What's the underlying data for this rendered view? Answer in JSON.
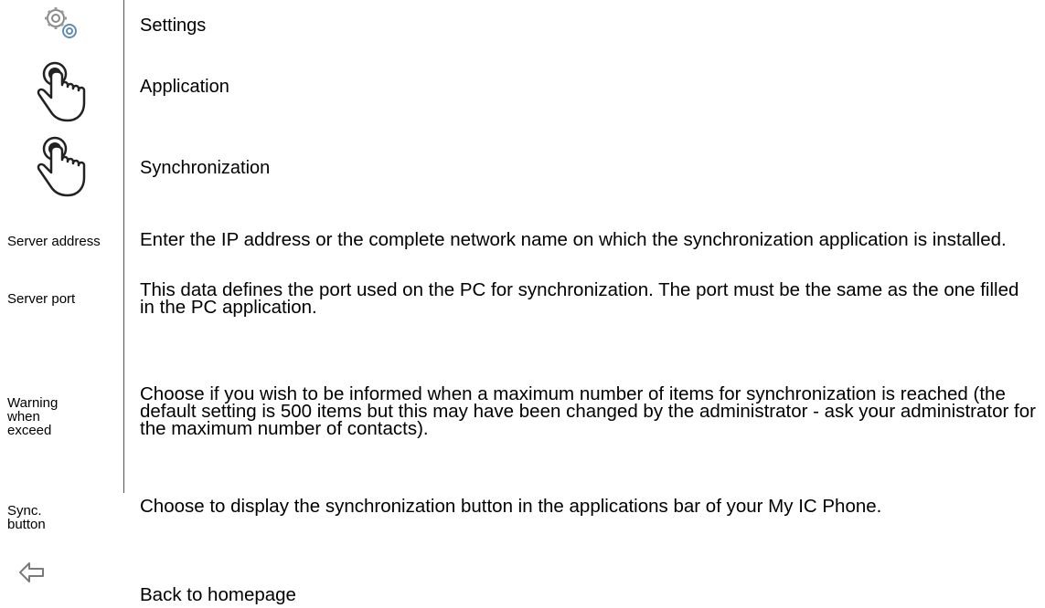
{
  "steps": [
    {
      "label": "Settings",
      "icon": "gears-icon"
    },
    {
      "label": "Application",
      "icon": "hand-press-icon"
    },
    {
      "label": "Synchronization",
      "icon": "hand-press-icon"
    }
  ],
  "fields": [
    {
      "term": "Server address",
      "description": "Enter the IP address or the complete network name on which the synchronization application is installed."
    },
    {
      "term": "Server port",
      "description": "This data defines the port used on the PC for synchronization. The port must be the same as the one filled in the PC application."
    },
    {
      "term": "Warning when exceed",
      "description": "Choose if you wish to be informed when a maximum number of items for synchronization is reached (the default setting is 500 items but this may have been changed by the administrator - ask your administrator for the maximum number of contacts)."
    },
    {
      "term": "Sync. button",
      "description": "Choose to display the synchronization button in the applications bar of your My IC Phone."
    }
  ],
  "back": {
    "label": "Back to homepage",
    "icon": "back-arrow-icon"
  }
}
